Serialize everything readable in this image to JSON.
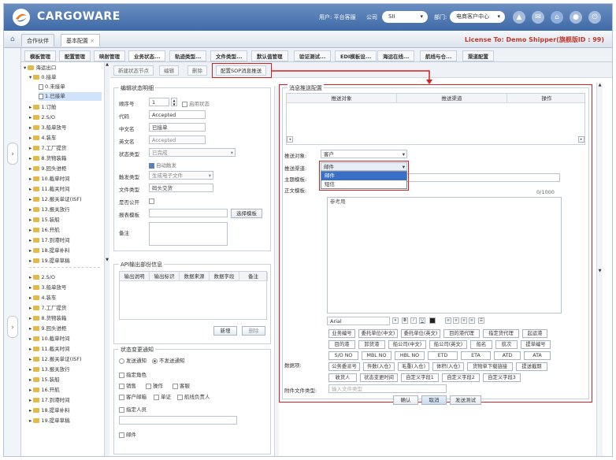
{
  "header": {
    "brand": "CARGOWARE",
    "user_label": "用户: 平台客服",
    "company_label": "公司",
    "company_value": "SII",
    "dept_label": "部门:",
    "dept_value": "电商客户中心",
    "icons": [
      "bell-icon",
      "mail-icon",
      "home-icon",
      "user-icon",
      "power-icon"
    ]
  },
  "tabs": {
    "items": [
      "合作伙伴",
      "基本配置"
    ],
    "active": "基本配置",
    "license": "License To: Demo Shipper(旗舰版ID : 99)"
  },
  "subnav": {
    "items": [
      "模板管理",
      "配置管理",
      "映射管理",
      "业务状态...",
      "轨迹类型...",
      "文件类型...",
      "默认值管理",
      "验证测试...",
      "EDI模板设...",
      "海运在线...",
      "航线与仓...",
      "渠道配置"
    ],
    "active": "业务状态..."
  },
  "tree": {
    "nodes": [
      {
        "label": "海运出口",
        "level": 0,
        "type": "folder",
        "expanded": true
      },
      {
        "label": "0.接单",
        "level": 1,
        "type": "folder",
        "expanded": true
      },
      {
        "label": "0.未接单",
        "level": 2,
        "type": "doc"
      },
      {
        "label": "1.已接单",
        "level": 2,
        "type": "doc",
        "selected": true
      },
      {
        "label": "1.订舱",
        "level": 1,
        "type": "folder"
      },
      {
        "label": "2.S/O",
        "level": 1,
        "type": "folder"
      },
      {
        "label": "3.船单放号",
        "level": 1,
        "type": "folder"
      },
      {
        "label": "4.装车",
        "level": 1,
        "type": "folder"
      },
      {
        "label": "7.工厂提货",
        "level": 1,
        "type": "folder"
      },
      {
        "label": "8.货物装箱",
        "level": 1,
        "type": "folder"
      },
      {
        "label": "9.回头进柜",
        "level": 1,
        "type": "folder"
      },
      {
        "label": "10.截单时间",
        "level": 1,
        "type": "folder"
      },
      {
        "label": "11.截关时间",
        "level": 1,
        "type": "folder"
      },
      {
        "label": "12.报关单证(ISF)",
        "level": 1,
        "type": "folder"
      },
      {
        "label": "13.报关放行",
        "level": 1,
        "type": "folder"
      },
      {
        "label": "15.装船",
        "level": 1,
        "type": "folder"
      },
      {
        "label": "16.开航",
        "level": 1,
        "type": "folder"
      },
      {
        "label": "17.到港时间",
        "level": 1,
        "type": "folder"
      },
      {
        "label": "18.提单补料",
        "level": 1,
        "type": "folder"
      },
      {
        "label": "19.提单草稿",
        "level": 1,
        "type": "folder"
      }
    ],
    "nodes_repeat": [
      {
        "label": "2.S/O",
        "level": 1
      },
      {
        "label": "3.船单放号",
        "level": 1
      },
      {
        "label": "4.装车",
        "level": 1
      },
      {
        "label": "7.工厂提货",
        "level": 1
      },
      {
        "label": "8.货物装箱",
        "level": 1
      },
      {
        "label": "9.回头进柜",
        "level": 1
      },
      {
        "label": "10.截单时间",
        "level": 1
      },
      {
        "label": "11.截关时间",
        "level": 1
      },
      {
        "label": "12.报关单证(ISF)",
        "level": 1
      },
      {
        "label": "13.报关放行",
        "level": 1
      },
      {
        "label": "15.装船",
        "level": 1
      },
      {
        "label": "16.开航",
        "level": 1
      },
      {
        "label": "17.到港时间",
        "level": 1
      },
      {
        "label": "18.提单补料",
        "level": 1
      },
      {
        "label": "19.提单草稿",
        "level": 1
      }
    ]
  },
  "toolbar": {
    "buttons": [
      "新建状态节点",
      "编辑",
      "删除"
    ],
    "sop_button": "配置SOP消息推送"
  },
  "edit_form": {
    "legend": "编辑状态明细",
    "order_label": "顺序号",
    "order_value": "1",
    "enabled_label": "启用状态",
    "code_label": "代码",
    "code_value": "Accepted",
    "cn_label": "中文名",
    "cn_value": "已接单",
    "en_label": "英文名",
    "en_value": "Accepted",
    "status_type_label": "状态类型",
    "status_type_value": "已完成",
    "auto_trigger_label": "自动触发",
    "trigger_type_label": "触发类型",
    "trigger_type_value": "生成电子文件",
    "file_type_label": "文件类型",
    "file_type_value": "码头交货",
    "public_label": "是否公开",
    "report_tpl_label": "报表模板",
    "report_tpl_btn": "选择模板",
    "remark_label": "备注"
  },
  "api_section": {
    "legend": "API输出部份信息",
    "columns": [
      "输出说明",
      "输出标识",
      "数据来源",
      "数据字段",
      "备注"
    ],
    "add_btn": "新增",
    "del_btn": "删除"
  },
  "notify_section": {
    "legend": "状态变更通知",
    "radio_send": "发送通知",
    "radio_nosend": "不发送通知",
    "group_label": "指定角色",
    "role_sales": "销售",
    "role_ops": "操作",
    "role_service": "客服",
    "role_docs": "客户邮箱",
    "role_doc": "单证",
    "role_manager": "航线负责人",
    "assign_person_label": "指定人员",
    "email_label": "邮件"
  },
  "push_config": {
    "legend": "消息推送配置",
    "columns": [
      "推送对象",
      "推送渠道",
      "操作"
    ],
    "target_label": "推送对象:",
    "target_value": "客户",
    "channel_label": "推送渠道:",
    "channel_value": "邮件",
    "channel_options": [
      "邮件",
      "短信"
    ],
    "subject_label": "主题模板:",
    "body_label": "正文模板:",
    "body_placeholder": "参考用",
    "counter": "0/1000",
    "font_value": "Arial",
    "data_item_label": "数据项:",
    "attach_label": "附件文件类型:",
    "attach_placeholder": "输入文件类型",
    "ok_btn": "确认",
    "cancel_btn": "取消",
    "test_btn": "发送测试",
    "tags_rows": [
      [
        "业务编号",
        "委托单位(中文)",
        "委托单位(英文)",
        "目的港代理",
        "指定货代理",
        "起运港"
      ],
      [
        "目的港",
        "卸货港",
        "船公司(中文)",
        "船公司(英文)",
        "船名",
        "航次",
        "提单编号"
      ],
      [
        "S/O NO",
        "MBL NO",
        "HBL NO",
        "ETD",
        "ETA",
        "ATD",
        "ATA"
      ],
      [
        "公务委派号",
        "件数(入仓)",
        "毛重(入仓)",
        "体积(入仓)",
        "货物单下载链接",
        "提送截期"
      ],
      [
        "收货人",
        "状态变更时间",
        "自定义字段1",
        "自定义字段2",
        "自定义字段3"
      ]
    ]
  }
}
